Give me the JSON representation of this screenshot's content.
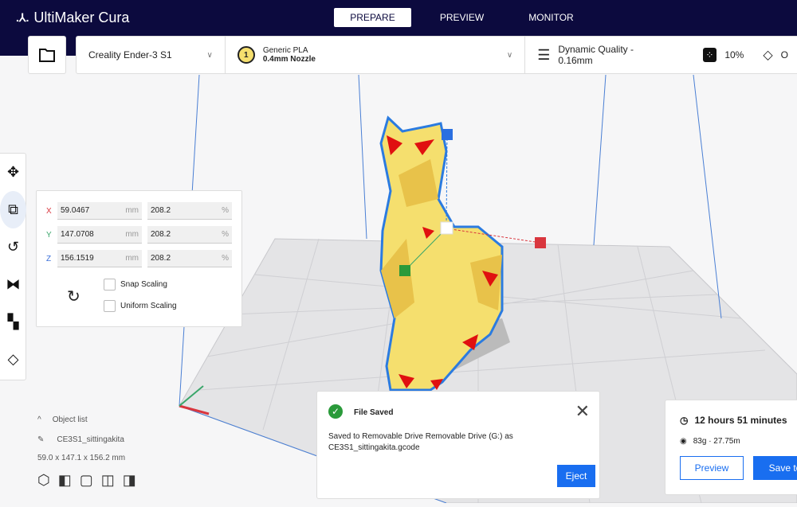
{
  "app": {
    "title": "UltiMaker Cura"
  },
  "tabs": [
    {
      "label": "PREPARE",
      "active": true
    },
    {
      "label": "PREVIEW"
    },
    {
      "label": "MONITOR"
    }
  ],
  "stage": {
    "printer": "Creality Ender-3 S1",
    "extruder_number": "1",
    "material": "Generic PLA",
    "nozzle": "0.4mm Nozzle",
    "quality": "Dynamic Quality - 0.16mm",
    "infill": "10%",
    "support_partial": "O"
  },
  "scale_panel": {
    "rows": [
      {
        "axis": "X",
        "mm": "59.0467",
        "unit": "mm",
        "pct": "208.2",
        "pct_unit": "%",
        "color": "#d9363e"
      },
      {
        "axis": "Y",
        "mm": "147.0708",
        "unit": "mm",
        "pct": "208.2",
        "pct_unit": "%",
        "color": "#3aa66a"
      },
      {
        "axis": "Z",
        "mm": "156.1519",
        "unit": "mm",
        "pct": "208.2",
        "pct_unit": "%",
        "color": "#3b6fd9"
      }
    ],
    "snap": "Snap Scaling",
    "uniform": "Uniform Scaling"
  },
  "object_list": {
    "label": "Object list",
    "name": "CE3S1_sittingakita",
    "dims": "59.0 x 147.1 x 156.2 mm"
  },
  "toast": {
    "title": "File Saved",
    "message": "Saved to Removable Drive Removable Drive (G:) as CE3S1_sittingakita.gcode",
    "eject": "Eject"
  },
  "print": {
    "time": "12 hours 51 minutes",
    "material": "83g · 27.75m",
    "preview": "Preview",
    "save": "Save to"
  },
  "colors": {
    "header": "#0c0a3e",
    "accent": "#196ef0",
    "model": "#f5df6e"
  }
}
